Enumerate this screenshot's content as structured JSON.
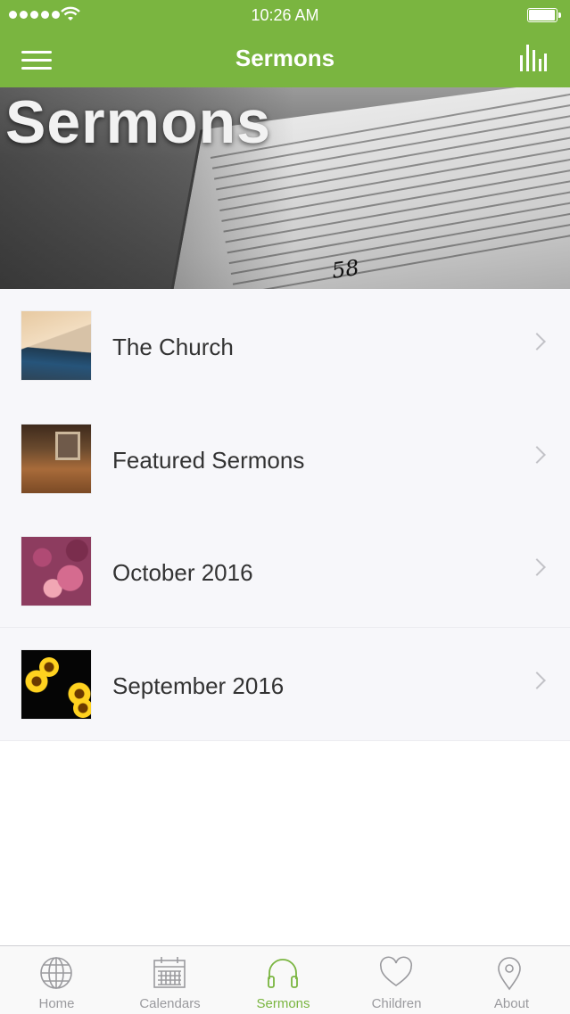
{
  "status_bar": {
    "time": "10:26 AM"
  },
  "nav": {
    "title": "Sermons"
  },
  "hero": {
    "title": "Sermons",
    "verse_number": "58"
  },
  "list": {
    "items": [
      {
        "label": "The Church"
      },
      {
        "label": "Featured Sermons"
      },
      {
        "label": "October 2016"
      },
      {
        "label": "September 2016"
      }
    ]
  },
  "tab_bar": {
    "tabs": [
      {
        "label": "Home",
        "icon": "globe-icon"
      },
      {
        "label": "Calendars",
        "icon": "calendar-icon"
      },
      {
        "label": "Sermons",
        "icon": "headphones-icon",
        "active": true
      },
      {
        "label": "Children",
        "icon": "heart-icon"
      },
      {
        "label": "About",
        "icon": "location-pin-icon"
      }
    ]
  },
  "colors": {
    "accent": "#7ab540",
    "inactive": "#9a9a9e",
    "list_bg": "#f7f7fa"
  }
}
